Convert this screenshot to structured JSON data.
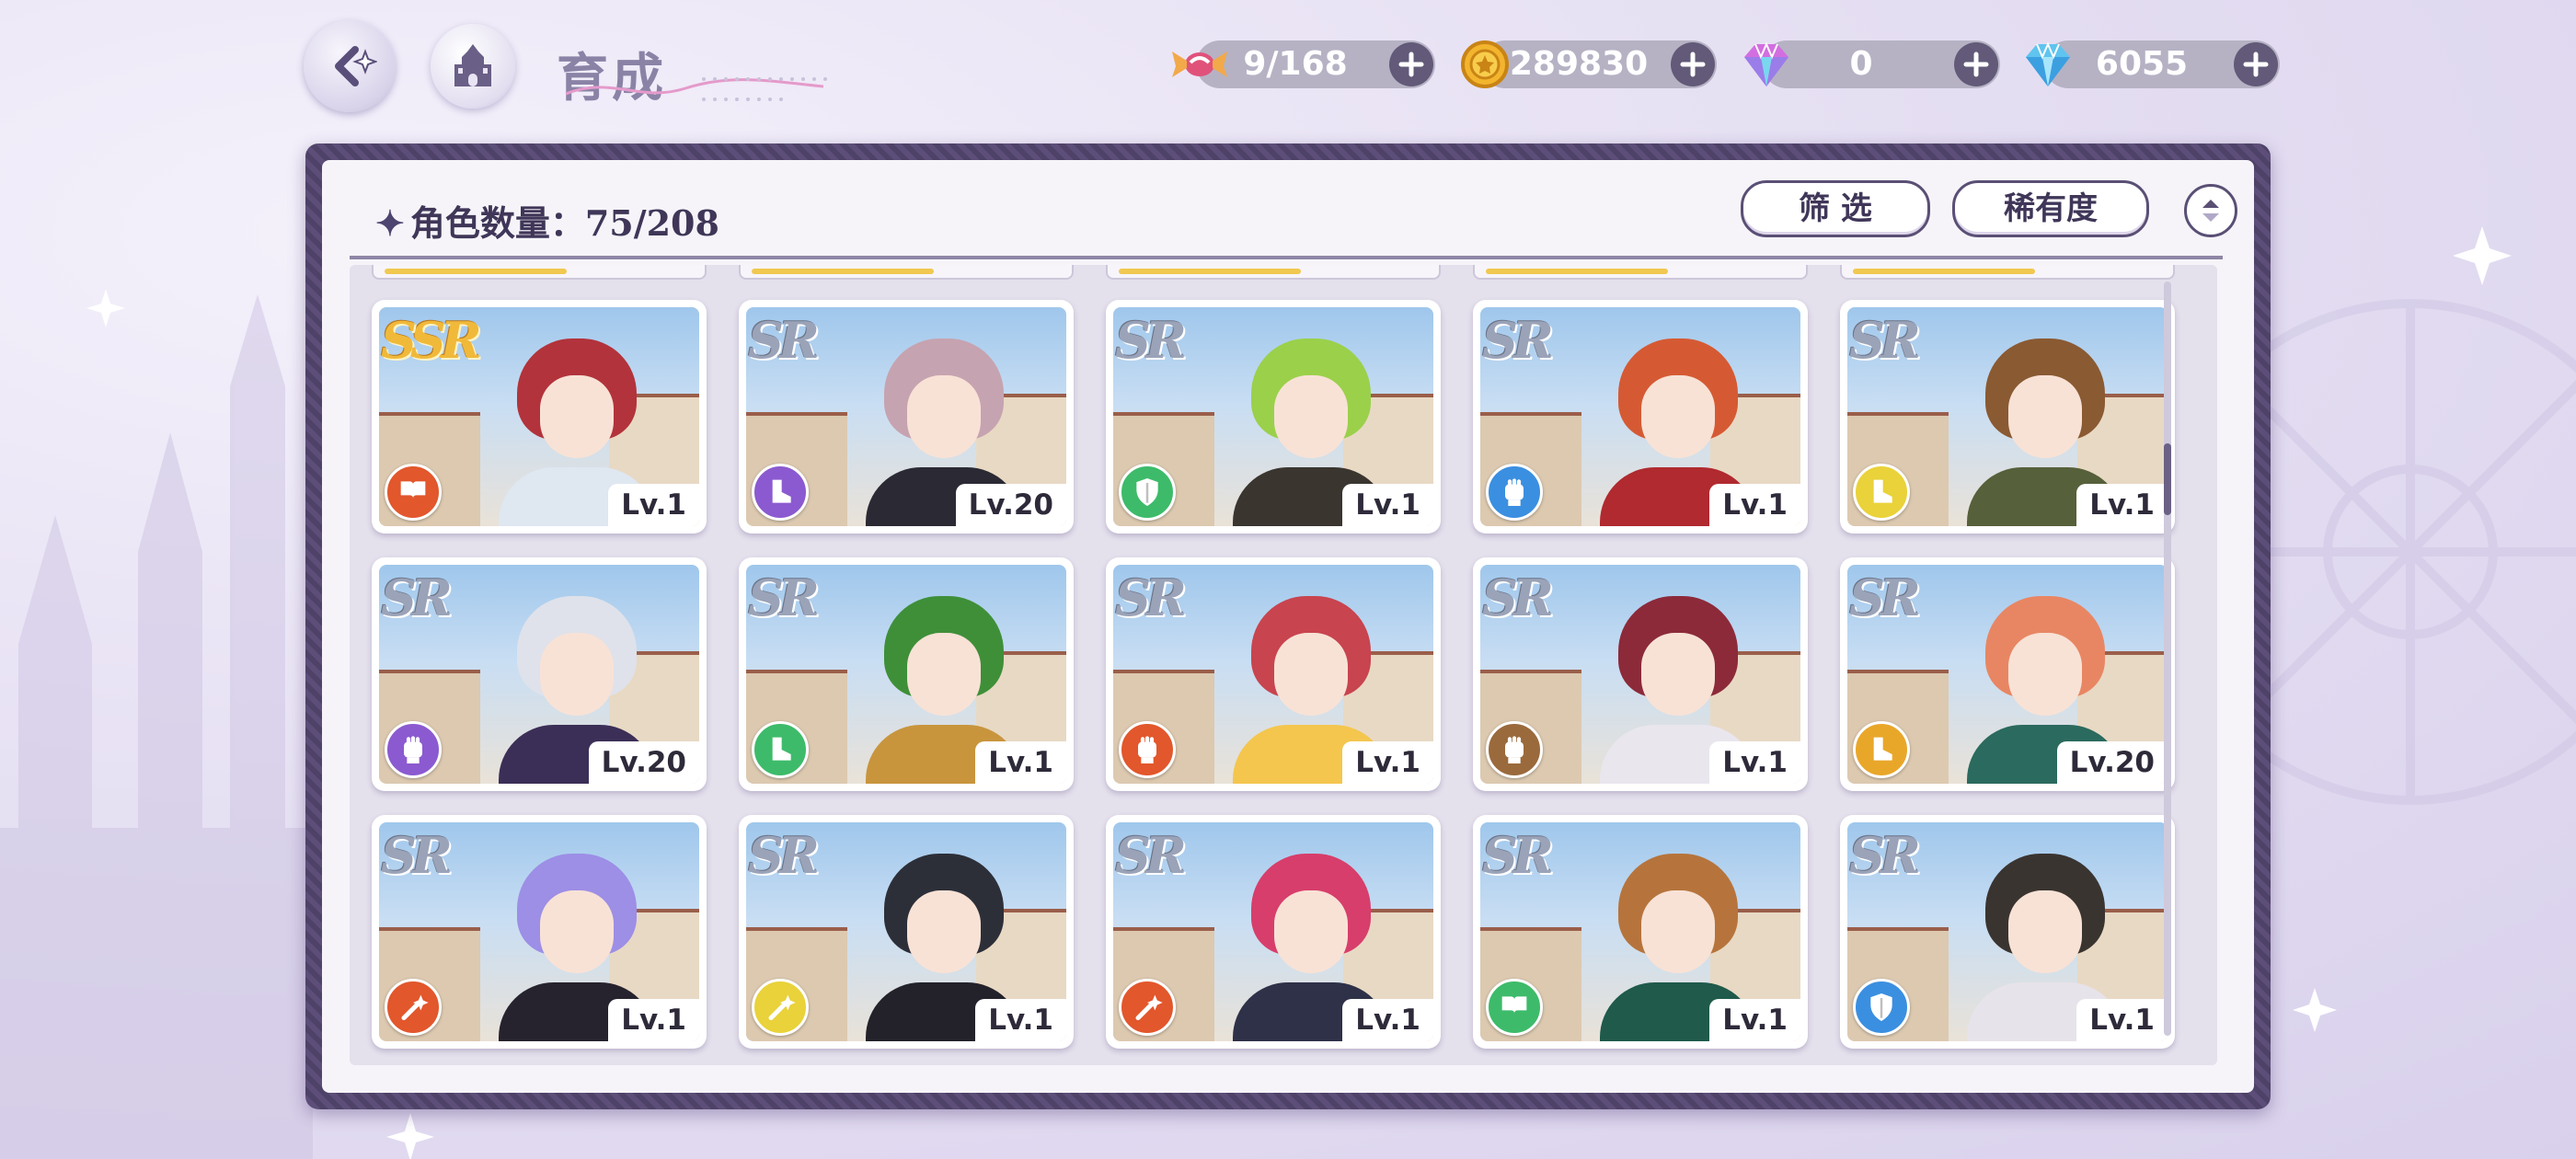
{
  "app": {
    "page_title": "育成"
  },
  "resources": [
    {
      "name": "candy",
      "value": "9/168",
      "icon": "candy-icon",
      "color": "#e0527a"
    },
    {
      "name": "coin",
      "value": "289830",
      "icon": "gold-coin-icon",
      "color": "#f3b52e"
    },
    {
      "name": "rainbow-gem",
      "value": "0",
      "icon": "rainbow-diamond-icon",
      "color": "#d36ee0"
    },
    {
      "name": "diamond",
      "value": "6055",
      "icon": "blue-diamond-icon",
      "color": "#5fc4ef"
    }
  ],
  "panel": {
    "count_label": "角色数量：75/208",
    "filter_button": "筛 选",
    "rarity_button": "稀有度"
  },
  "roles": {
    "orange": "#e2572c",
    "purple": "#8b5ad0",
    "green": "#3dbb6a",
    "blue": "#3b8fe0",
    "yellow": "#e9d23a",
    "brown": "#9a6a3c"
  },
  "cards": [
    {
      "rarity": "SSR",
      "level": "Lv.1",
      "role_color": "#e2572c",
      "role_icon": "book-icon",
      "hair": "#b2333b",
      "outfit": "#dfe7f1"
    },
    {
      "rarity": "SR",
      "level": "Lv.20",
      "role_color": "#8b5ad0",
      "role_icon": "boot-icon",
      "hair": "#c6a3b0",
      "outfit": "#2b2a34"
    },
    {
      "rarity": "SR",
      "level": "Lv.1",
      "role_color": "#3dbb6a",
      "role_icon": "shield-icon",
      "hair": "#9bd04b",
      "outfit": "#3a352f"
    },
    {
      "rarity": "SR",
      "level": "Lv.1",
      "role_color": "#3b8fe0",
      "role_icon": "fist-icon",
      "hair": "#d55a33",
      "outfit": "#b02a2f"
    },
    {
      "rarity": "SR",
      "level": "Lv.1",
      "role_color": "#e9d23a",
      "role_icon": "boot-icon",
      "hair": "#8a5a32",
      "outfit": "#56603a"
    },
    {
      "rarity": "SR",
      "level": "Lv.20",
      "role_color": "#8b5ad0",
      "role_icon": "fist-icon",
      "hair": "#dfe2ea",
      "outfit": "#3b2f57"
    },
    {
      "rarity": "SR",
      "level": "Lv.1",
      "role_color": "#3dbb6a",
      "role_icon": "boot-icon",
      "hair": "#3f8f39",
      "outfit": "#c8953d"
    },
    {
      "rarity": "SR",
      "level": "Lv.1",
      "role_color": "#e2572c",
      "role_icon": "fist-icon",
      "hair": "#c8444f",
      "outfit": "#f4c64e"
    },
    {
      "rarity": "SR",
      "level": "Lv.1",
      "role_color": "#9a6a3c",
      "role_icon": "fist-icon",
      "hair": "#8c2a3a",
      "outfit": "#e9e6ee"
    },
    {
      "rarity": "SR",
      "level": "Lv.20",
      "role_color": "#e9a72a",
      "role_icon": "boot-icon",
      "hair": "#e88663",
      "outfit": "#2b6a5e"
    },
    {
      "rarity": "SR",
      "level": "Lv.1",
      "role_color": "#e2572c",
      "role_icon": "wand-icon",
      "hair": "#9d8ee6",
      "outfit": "#26232e"
    },
    {
      "rarity": "SR",
      "level": "Lv.1",
      "role_color": "#e9d23a",
      "role_icon": "wand-icon",
      "hair": "#2d2f38",
      "outfit": "#23222a"
    },
    {
      "rarity": "SR",
      "level": "Lv.1",
      "role_color": "#e2572c",
      "role_icon": "wand-icon",
      "hair": "#d73e6b",
      "outfit": "#2e3148"
    },
    {
      "rarity": "SR",
      "level": "Lv.1",
      "role_color": "#3dbb6a",
      "role_icon": "book-icon",
      "hair": "#b6743c",
      "outfit": "#1f5a4a"
    },
    {
      "rarity": "SR",
      "level": "Lv.1",
      "role_color": "#3b8fe0",
      "role_icon": "shield-icon",
      "hair": "#3a3430",
      "outfit": "#e7e3ea"
    }
  ]
}
